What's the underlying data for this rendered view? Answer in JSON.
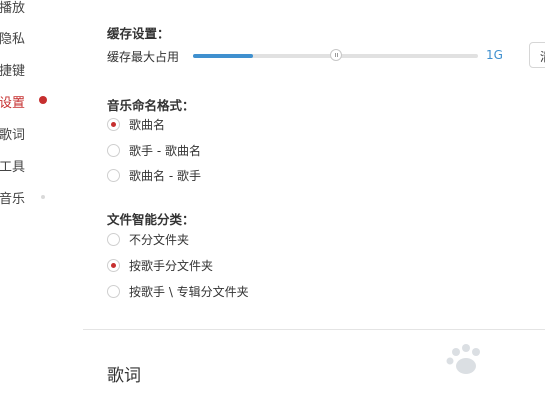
{
  "sidebar": {
    "items": [
      {
        "label": "播放",
        "active": false
      },
      {
        "label": "隐私",
        "active": false
      },
      {
        "label": "捷键",
        "active": false
      },
      {
        "label": "设置",
        "active": true
      },
      {
        "label": "歌词",
        "active": false
      },
      {
        "label": "工具",
        "active": false
      },
      {
        "label": "音乐",
        "active": false
      }
    ]
  },
  "cache": {
    "section_title": "缓存设置：",
    "label": "缓存最大占用",
    "slider_value_fraction": 0.21,
    "max_label": "1G",
    "edge_button_label": "清"
  },
  "naming": {
    "section_title": "音乐命名格式：",
    "options": [
      {
        "label": "歌曲名",
        "checked": true
      },
      {
        "label": "歌手 - 歌曲名",
        "checked": false
      },
      {
        "label": "歌曲名 - 歌手",
        "checked": false
      }
    ]
  },
  "classify": {
    "section_title": "文件智能分类：",
    "options": [
      {
        "label": "不分文件夹",
        "checked": false
      },
      {
        "label": "按歌手分文件夹",
        "checked": true
      },
      {
        "label": "按歌手 \\ 专辑分文件夹",
        "checked": false
      }
    ]
  },
  "lyrics": {
    "heading": "歌词"
  },
  "colors": {
    "accent_red": "#c62f2f",
    "slider_blue": "#3f90cf"
  }
}
